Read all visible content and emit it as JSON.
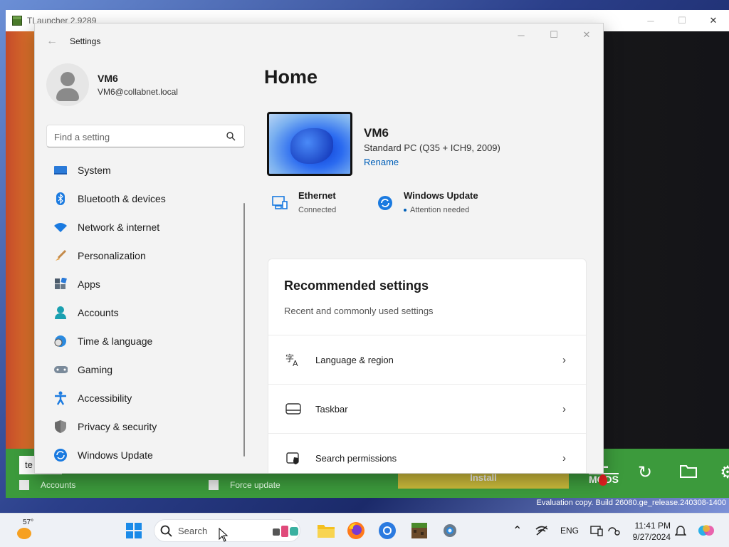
{
  "tlauncher": {
    "title": "TLauncher 2.9289",
    "input_value": "te",
    "checkboxes": [
      "Accounts",
      "Force update"
    ],
    "install_label": "Install",
    "mods_logo_top": "L",
    "mods_logo_bottom": "MODS"
  },
  "settings": {
    "window_title": "Settings",
    "user": {
      "name": "VM6",
      "email": "VM6@collabnet.local"
    },
    "search_placeholder": "Find a setting",
    "nav": [
      {
        "label": "System",
        "icon": "system-icon"
      },
      {
        "label": "Bluetooth & devices",
        "icon": "bluetooth-icon"
      },
      {
        "label": "Network & internet",
        "icon": "wifi-icon"
      },
      {
        "label": "Personalization",
        "icon": "brush-icon"
      },
      {
        "label": "Apps",
        "icon": "apps-icon"
      },
      {
        "label": "Accounts",
        "icon": "accounts-icon"
      },
      {
        "label": "Time & language",
        "icon": "globe-clock-icon"
      },
      {
        "label": "Gaming",
        "icon": "gamepad-icon"
      },
      {
        "label": "Accessibility",
        "icon": "accessibility-icon"
      },
      {
        "label": "Privacy & security",
        "icon": "shield-icon"
      },
      {
        "label": "Windows Update",
        "icon": "update-icon"
      }
    ],
    "home": {
      "title": "Home",
      "device_name": "VM6",
      "device_model": "Standard PC (Q35 + ICH9, 2009)",
      "rename_label": "Rename",
      "ethernet": {
        "title": "Ethernet",
        "status": "Connected"
      },
      "windows_update": {
        "title": "Windows Update",
        "status": "Attention needed"
      },
      "recommended": {
        "title": "Recommended settings",
        "subtitle": "Recent and commonly used settings",
        "items": [
          {
            "label": "Language & region",
            "icon": "language-icon"
          },
          {
            "label": "Taskbar",
            "icon": "taskbar-icon"
          },
          {
            "label": "Search permissions",
            "icon": "search-permissions-icon"
          }
        ]
      }
    }
  },
  "watermark": "Evaluation copy. Build 26080.ge_release.240308-1400",
  "taskbar": {
    "weather_temp": "57°",
    "search_label": "Search",
    "language": "ENG",
    "time": "11:41 PM",
    "date": "9/27/2024"
  },
  "colors": {
    "accent": "#005fb8",
    "tlauncher_green": "#3c9a3c",
    "install_yellow": "#c8b83a"
  }
}
